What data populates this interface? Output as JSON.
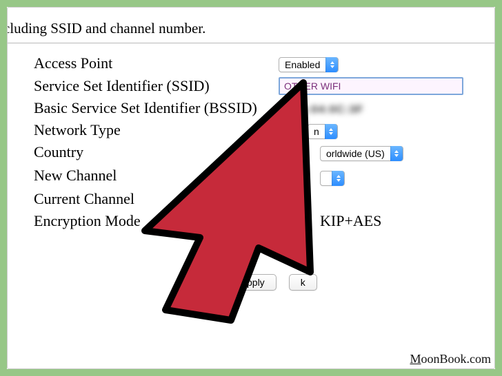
{
  "header": {
    "fragment": "cluding SSID and channel number."
  },
  "fields": {
    "access_point": {
      "label": "Access Point",
      "value": "Enabled"
    },
    "ssid": {
      "label": "Service Set Identifier (SSID)",
      "value": "OTHER WIFI"
    },
    "bssid": {
      "label": "Basic Service Set Identifier (BSSID)",
      "value": "7:BA:04:0C:3F"
    },
    "network_type": {
      "label": "Network Type",
      "value_visible_suffix": "n"
    },
    "country": {
      "label": "Country",
      "value_visible_suffix": "orldwide (US)"
    },
    "new_channel": {
      "label": "New Channel",
      "value_visible_suffix": ""
    },
    "current_channel": {
      "label": "Current Channel"
    },
    "encryption_mode": {
      "label": "Encryption Mode",
      "value_visible_suffix": "KIP+AES"
    }
  },
  "buttons": {
    "apply_visible": "pply",
    "back_visible": "k"
  },
  "watermark": "MoonBook.com",
  "colors": {
    "frame_green": "#97c787",
    "arrow_red": "#c62a3a",
    "select_blue_top": "#6bb7ff",
    "select_blue_bottom": "#2d8dff",
    "input_border": "#7da7db",
    "input_text": "#7b2f7b"
  }
}
